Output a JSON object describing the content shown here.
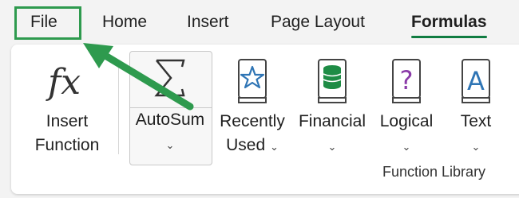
{
  "tabs": [
    {
      "label": "File",
      "active": false,
      "highlighted": true
    },
    {
      "label": "Home",
      "active": false
    },
    {
      "label": "Insert",
      "active": false
    },
    {
      "label": "Page Layout",
      "active": false
    },
    {
      "label": "Formulas",
      "active": true
    }
  ],
  "ribbon": {
    "insert_function": {
      "icon": "fx-icon",
      "label_line1": "Insert",
      "label_line2": "Function"
    },
    "autosum": {
      "icon": "sigma-icon",
      "label": "AutoSum"
    },
    "recently_used": {
      "icon": "star-book-icon",
      "label_line1": "Recently",
      "label_line2": "Used"
    },
    "financial": {
      "icon": "database-book-icon",
      "label": "Financial"
    },
    "logical": {
      "icon": "question-book-icon",
      "label": "Logical"
    },
    "text": {
      "icon": "letter-a-book-icon",
      "label": "Text"
    },
    "group_label": "Function Library"
  },
  "annotation": {
    "color": "#2e9a4e",
    "points_to": "File"
  },
  "colors": {
    "accent": "#107c41",
    "highlight": "#2e9a4e",
    "icon_blue": "#2f75b5",
    "icon_green": "#1e8c45",
    "icon_purple": "#8a3aa8"
  }
}
